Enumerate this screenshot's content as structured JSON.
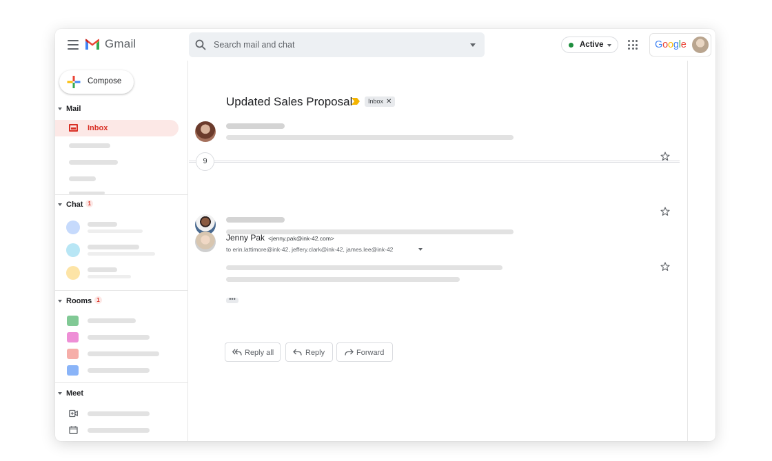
{
  "header": {
    "brand": "Gmail",
    "search_placeholder": "Search mail and chat",
    "status_label": "Active",
    "account_word": "Google"
  },
  "sidebar": {
    "compose_label": "Compose",
    "mail_section": "Mail",
    "inbox_label": "Inbox",
    "chat_section": "Chat",
    "chat_count": "1",
    "rooms_section": "Rooms",
    "rooms_count": "1",
    "meet_section": "Meet"
  },
  "thread": {
    "subject": "Updated Sales Proposal",
    "label": "Inbox",
    "collapsed_count": "9",
    "sender_name": "Jenny Pak",
    "sender_email": "<jenny.pak@ink-42.com>",
    "recipients": "to erin.lattimore@ink-42, jeffery.clark@ink-42, james.lee@ink-42",
    "more_glyph": "•••"
  },
  "actions": {
    "reply_all": "Reply all",
    "reply": "Reply",
    "forward": "Forward"
  },
  "colors": {
    "accent_red": "#d93025",
    "active_green": "#1e8e3e",
    "room_colors": [
      "#81c995",
      "#ee8fd6",
      "#f6aea9",
      "#8ab4f8"
    ],
    "chat_avatar_colors": [
      "#c6dafc",
      "#b8e6f5",
      "#fde4a6"
    ]
  }
}
